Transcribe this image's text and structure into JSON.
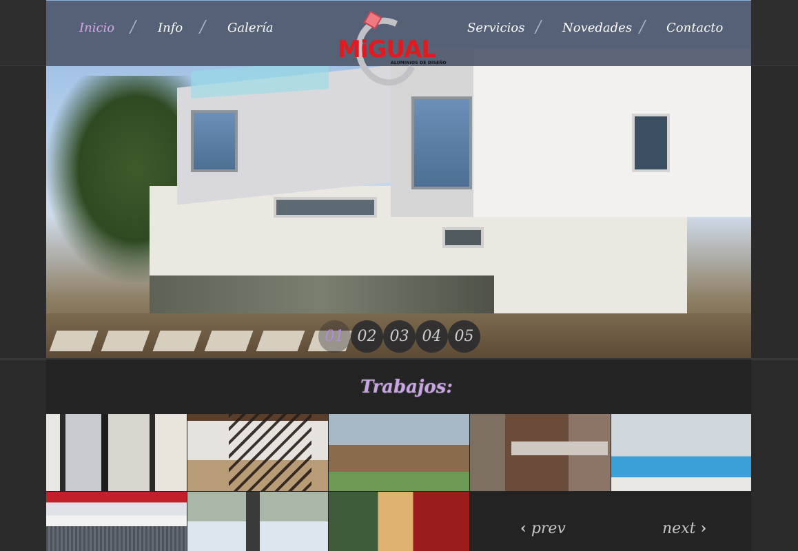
{
  "nav": {
    "left": [
      "Inicio",
      "Info",
      "Galería"
    ],
    "right": [
      "Servicios",
      "Novedades",
      "Contacto"
    ],
    "separator": "/",
    "active_color": "#d5a6e8"
  },
  "logo": {
    "text": "MiGUAL",
    "subtitle": "ALUMINIOS DE DISEÑO",
    "brand_color": "#e4181f"
  },
  "slider": {
    "pager": [
      "01",
      "02",
      "03",
      "04",
      "05"
    ],
    "active_index": 0
  },
  "works": {
    "title": "Trabajos:",
    "prev_label": "prev",
    "next_label": "next",
    "title_color": "#c9a3e3"
  },
  "icons": {
    "prev": "chevron-left-icon",
    "next": "chevron-right-icon"
  }
}
